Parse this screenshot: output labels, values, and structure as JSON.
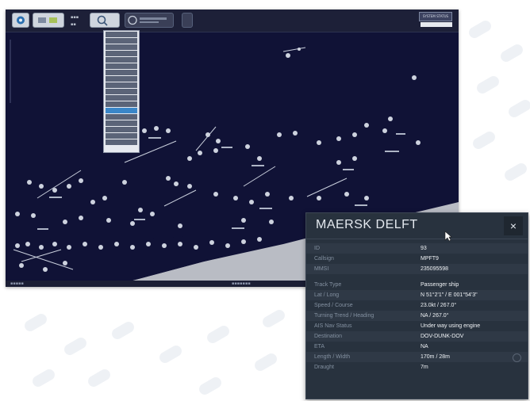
{
  "toolbar": {
    "status_label": "SYSTEM STATUS"
  },
  "panel": {
    "title": "MAERSK DELFT",
    "close_glyph": "×",
    "rows": [
      {
        "key": "ID",
        "value": "93"
      },
      {
        "key": "Callsign",
        "value": "MPFT9"
      },
      {
        "key": "MMSI",
        "value": "235095598"
      },
      {
        "key": "",
        "value": ""
      },
      {
        "key": "Track Type",
        "value": "Passenger ship"
      },
      {
        "key": "Lat / Long",
        "value": "N 51°2'1\" / E 001°54'3\""
      },
      {
        "key": "Speed / Course",
        "value": "23.0kt / 267.0°"
      },
      {
        "key": "Turning Trend / Heading",
        "value": "NA / 267.0°"
      },
      {
        "key": "AIS Nav Status",
        "value": "Under way using engine"
      },
      {
        "key": "Destination",
        "value": "DOV-DUNK-DOV"
      },
      {
        "key": "ETA",
        "value": "NA"
      },
      {
        "key": "Length / Width",
        "value": "170m / 28m"
      },
      {
        "key": "Draught",
        "value": "7m"
      }
    ]
  },
  "icons": [
    "app-logo-icon",
    "layers-icon",
    "search-icon",
    "close-icon",
    "cursor-icon"
  ],
  "colors": {
    "map_background": "#101236",
    "land": "#b9bcc4",
    "panel_background": "#28323e"
  }
}
